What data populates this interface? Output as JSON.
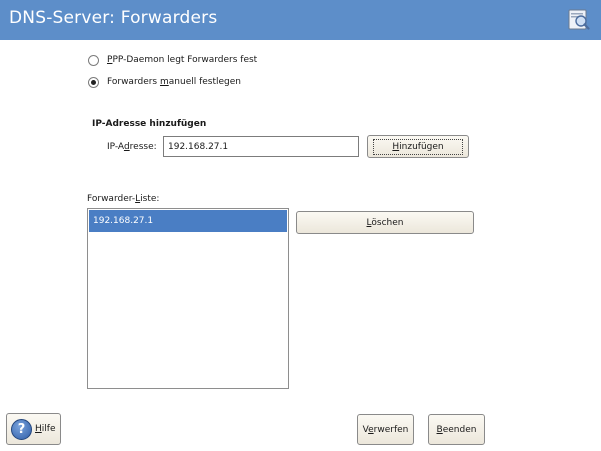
{
  "header": {
    "title": "DNS-Server: Forwarders",
    "icon": "dns-config-icon"
  },
  "mode": {
    "options": [
      {
        "pre": "",
        "key": "P",
        "post": "PP-Daemon legt Forwarders fest",
        "checked": false
      },
      {
        "pre": "Forwarders ",
        "key": "m",
        "post": "anuell festlegen",
        "checked": true
      }
    ]
  },
  "add_section": {
    "heading": "IP-Adresse hinzufügen",
    "label_pre": "IP-A",
    "label_key": "d",
    "label_post": "resse:",
    "value": "192.168.27.1",
    "button_key": "H",
    "button_post": "inzufügen"
  },
  "list": {
    "label_pre": "Forwarder-",
    "label_key": "L",
    "label_post": "iste:",
    "items": [
      "192.168.27.1"
    ],
    "delete_key": "L",
    "delete_post": "öschen"
  },
  "footer": {
    "help_key": "H",
    "help_post": "ilfe",
    "discard_pre": "V",
    "discard_key": "e",
    "discard_post": "rwerfen",
    "finish_pre": "",
    "finish_key": "B",
    "finish_post": "eenden"
  }
}
